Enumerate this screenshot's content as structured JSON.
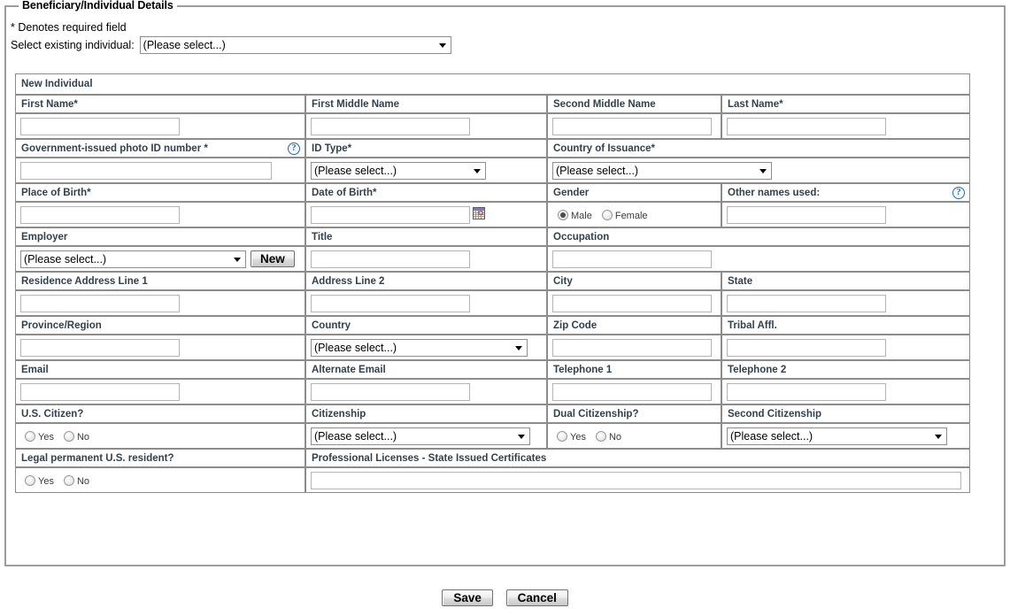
{
  "form": {
    "legend": "Beneficiary/Individual Details",
    "required_note": "* Denotes required field",
    "existing_label": "Select existing individual:",
    "existing_value": "(Please select...)",
    "section_title": "New Individual",
    "placeholder_select": "(Please select...)",
    "help_glyph": "?",
    "new_button": "New"
  },
  "fields": {
    "first_name": "First Name*",
    "first_middle_name": "First Middle Name",
    "second_middle_name": "Second Middle Name",
    "last_name": "Last Name*",
    "gov_id": "Government-issued photo ID number *",
    "id_type": "ID Type*",
    "country_of_issuance": "Country of Issuance*",
    "place_of_birth": "Place of Birth*",
    "date_of_birth": "Date of Birth*",
    "gender": "Gender",
    "other_names": "Other names used:",
    "employer": "Employer",
    "title": "Title",
    "occupation": "Occupation",
    "residence_address_1": "Residence Address Line 1",
    "address_line_2": "Address Line 2",
    "city": "City",
    "state": "State",
    "province_region": "Province/Region",
    "country": "Country",
    "zip_code": "Zip Code",
    "tribal_affl": "Tribal Affl.",
    "email": "Email",
    "alternate_email": "Alternate Email",
    "telephone_1": "Telephone 1",
    "telephone_2": "Telephone 2",
    "us_citizen": "U.S. Citizen?",
    "citizenship": "Citizenship",
    "dual_citizenship": "Dual Citizenship?",
    "second_citizenship": "Second Citizenship",
    "legal_permanent_resident": "Legal permanent U.S. resident?",
    "professional_licenses": "Professional Licenses - State Issued Certificates"
  },
  "values": {
    "first_name": "",
    "first_middle_name": "",
    "second_middle_name": "",
    "last_name": "",
    "gov_id": "",
    "id_type": "(Please select...)",
    "country_of_issuance": "(Please select...)",
    "place_of_birth": "",
    "date_of_birth": "",
    "gender": "Male",
    "other_names": "",
    "employer": "(Please select...)",
    "title": "",
    "occupation": "",
    "residence_address_1": "",
    "address_line_2": "",
    "city": "",
    "state": "",
    "province_region": "",
    "country": "(Please select...)",
    "zip_code": "",
    "tribal_affl": "",
    "email": "",
    "alternate_email": "",
    "telephone_1": "",
    "telephone_2": "",
    "citizenship": "(Please select...)",
    "second_citizenship": "(Please select...)",
    "professional_licenses": ""
  },
  "radio_options": {
    "male": "Male",
    "female": "Female",
    "yes": "Yes",
    "no": "No"
  },
  "buttons": {
    "save": "Save",
    "cancel": "Cancel"
  },
  "colors": {
    "header_bg": "#dedede",
    "header_text": "#33414e",
    "border": "#8c8c8c",
    "help_blue": "#2b6cb0"
  }
}
